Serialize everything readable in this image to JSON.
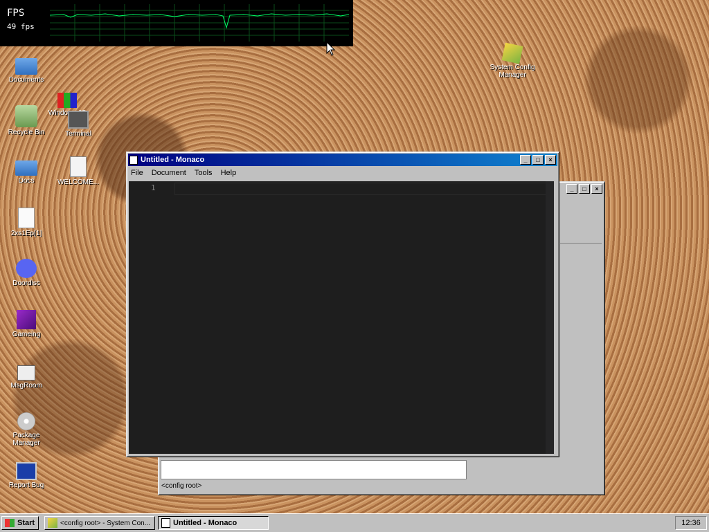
{
  "fps": {
    "label": "FPS",
    "value": "49 fps"
  },
  "desktop_icons": [
    {
      "label": "Documents"
    },
    {
      "label": "Recycle Bin"
    },
    {
      "label": "Windows 95"
    },
    {
      "label": "Terminal"
    },
    {
      "label": "Docs"
    },
    {
      "label": "WELCOME..."
    },
    {
      "label": "2xs1Ep[1]"
    },
    {
      "label": "Doordisc"
    },
    {
      "label": "Gameing"
    },
    {
      "label": "MsgRoom"
    },
    {
      "label": "Package Manager"
    },
    {
      "label": "Report Bug"
    },
    {
      "label": "System Config Manager"
    }
  ],
  "editor": {
    "title": "Untitled - Monaco",
    "menu": [
      "File",
      "Document",
      "Tools",
      "Help"
    ],
    "line_number": "1"
  },
  "config_window": {
    "status": "<config root>"
  },
  "taskbar": {
    "start": "Start",
    "tasks": [
      "<config root> - System Con...",
      "Untitled - Monaco"
    ],
    "clock": "12:36"
  },
  "colors": {
    "titlebar": "#000080",
    "editor_bg": "#1e1e1e",
    "graph_line": "#00ff66"
  }
}
